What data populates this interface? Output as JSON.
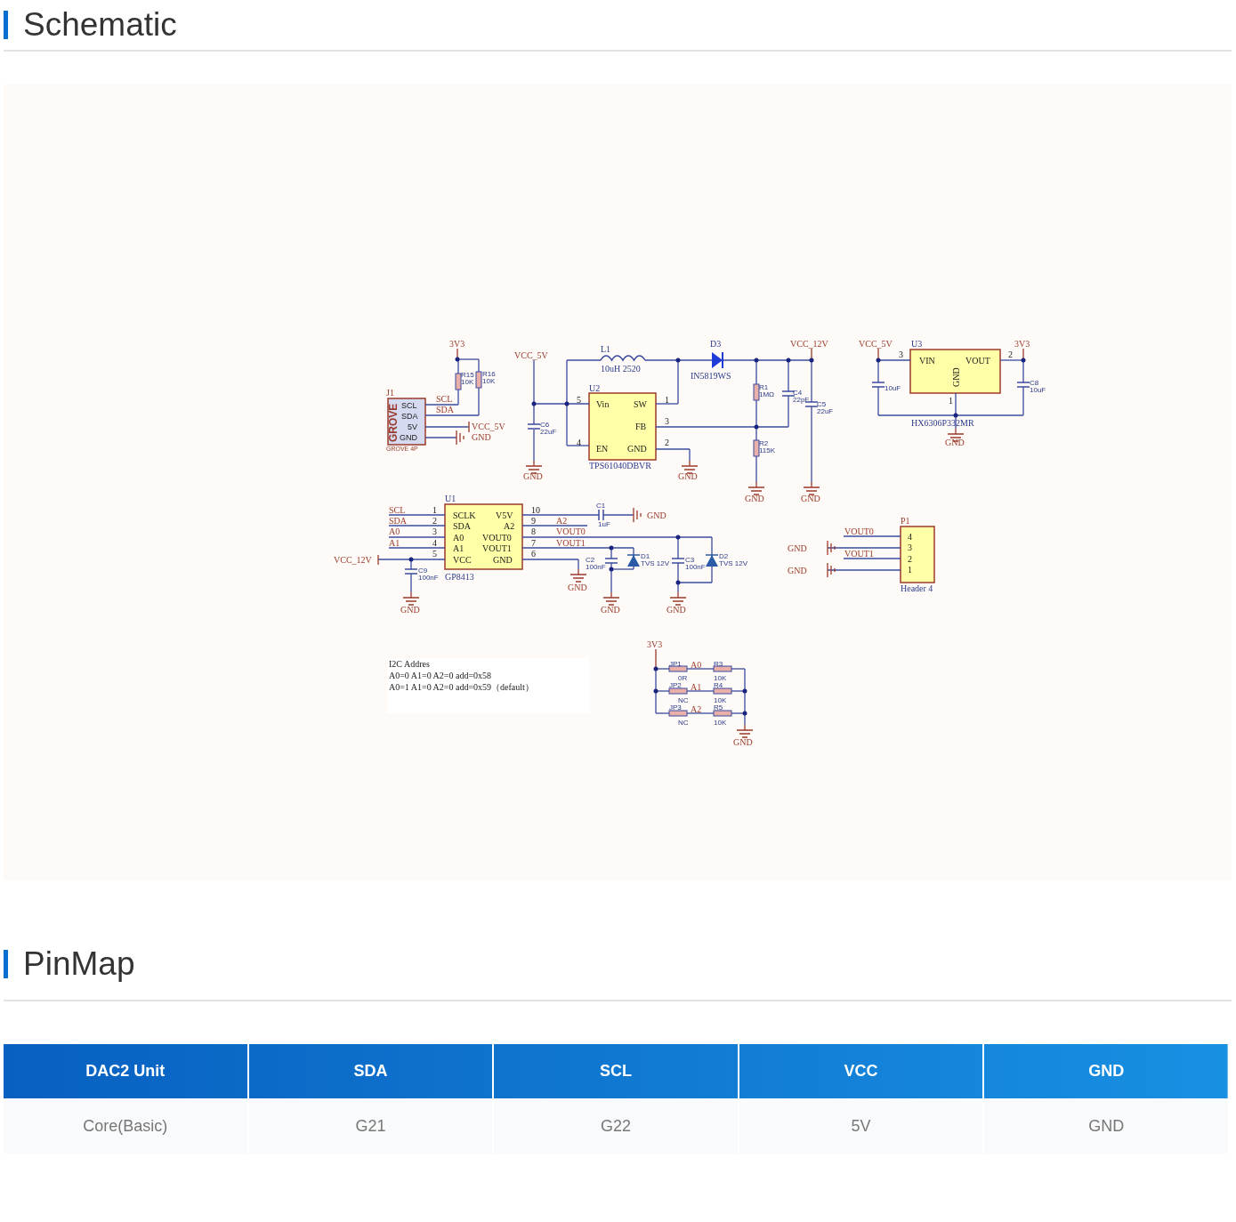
{
  "sections": [
    {
      "title": "Schematic"
    },
    {
      "title": "PinMap"
    }
  ],
  "schematic": {
    "labels": [
      {
        "text": "3V3",
        "kind": "net"
      },
      {
        "text": "R15",
        "kind": "value"
      },
      {
        "text": "10K",
        "kind": "value"
      },
      {
        "text": "R16",
        "kind": "value"
      },
      {
        "text": "10K",
        "kind": "value"
      },
      {
        "text": "J1",
        "kind": "net"
      },
      {
        "text": "GROVE",
        "kind": "grove"
      },
      {
        "text": "SCL",
        "kind": "sans"
      },
      {
        "text": "SDA",
        "kind": "sans"
      },
      {
        "text": "5V",
        "kind": "sans"
      },
      {
        "text": "GND",
        "kind": "sans"
      },
      {
        "text": "GROVE 4P",
        "kind": "small"
      },
      {
        "text": "SCL",
        "kind": "net"
      },
      {
        "text": "SDA",
        "kind": "net"
      },
      {
        "text": "VCC_5V",
        "kind": "net"
      },
      {
        "text": "GND",
        "kind": "net"
      },
      {
        "text": "VCC_5V",
        "kind": "net"
      },
      {
        "text": "C6",
        "kind": "value"
      },
      {
        "text": "22uF",
        "kind": "value"
      },
      {
        "text": "GND",
        "kind": "net"
      },
      {
        "text": "L1",
        "kind": "ref"
      },
      {
        "text": "10uH 2520",
        "kind": "ref"
      },
      {
        "text": "D3",
        "kind": "ref"
      },
      {
        "text": "VCC_12V",
        "kind": "net"
      },
      {
        "text": "IN5819WS",
        "kind": "ref"
      },
      {
        "text": "U2",
        "kind": "ref"
      },
      {
        "text": "5",
        "kind": "chip"
      },
      {
        "text": "Vin",
        "kind": "chip"
      },
      {
        "text": "SW",
        "kind": "chip"
      },
      {
        "text": "1",
        "kind": "chip"
      },
      {
        "text": "FB",
        "kind": "chip"
      },
      {
        "text": "3",
        "kind": "chip"
      },
      {
        "text": "4",
        "kind": "chip"
      },
      {
        "text": "EN",
        "kind": "chip"
      },
      {
        "text": "GND",
        "kind": "chip"
      },
      {
        "text": "2",
        "kind": "chip"
      },
      {
        "text": "TPS61040DBVR",
        "kind": "ref"
      },
      {
        "text": "GND",
        "kind": "net"
      },
      {
        "text": "R1",
        "kind": "value"
      },
      {
        "text": "1MΩ",
        "kind": "value"
      },
      {
        "text": "R2",
        "kind": "value"
      },
      {
        "text": "115K",
        "kind": "value"
      },
      {
        "text": "C4",
        "kind": "value"
      },
      {
        "text": "22pF",
        "kind": "value"
      },
      {
        "text": "C5",
        "kind": "value"
      },
      {
        "text": "22uF",
        "kind": "value"
      },
      {
        "text": "GND",
        "kind": "net"
      },
      {
        "text": "GND",
        "kind": "net"
      },
      {
        "text": "VCC_5V",
        "kind": "net"
      },
      {
        "text": "U3",
        "kind": "ref"
      },
      {
        "text": "3V3",
        "kind": "net"
      },
      {
        "text": "3",
        "kind": "chip"
      },
      {
        "text": "VIN",
        "kind": "chip"
      },
      {
        "text": "VOUT",
        "kind": "chip"
      },
      {
        "text": "2",
        "kind": "chip"
      },
      {
        "text": "GND",
        "kind": "chip"
      },
      {
        "text": "10uF",
        "kind": "value"
      },
      {
        "text": "C8",
        "kind": "value"
      },
      {
        "text": "10uF",
        "kind": "value"
      },
      {
        "text": "1",
        "kind": "chip"
      },
      {
        "text": "HX6306P332MR",
        "kind": "ref"
      },
      {
        "text": "GND",
        "kind": "net"
      },
      {
        "text": "U1",
        "kind": "ref"
      },
      {
        "text": "SCL",
        "kind": "net"
      },
      {
        "text": "SDA",
        "kind": "net"
      },
      {
        "text": "A0",
        "kind": "net"
      },
      {
        "text": "A1",
        "kind": "net"
      },
      {
        "text": "1",
        "kind": "chip"
      },
      {
        "text": "2",
        "kind": "chip"
      },
      {
        "text": "3",
        "kind": "chip"
      },
      {
        "text": "4",
        "kind": "chip"
      },
      {
        "text": "5",
        "kind": "chip"
      },
      {
        "text": "SCLK",
        "kind": "chip"
      },
      {
        "text": "V5V",
        "kind": "chip"
      },
      {
        "text": "SDA",
        "kind": "chip"
      },
      {
        "text": "A2",
        "kind": "chip"
      },
      {
        "text": "A0",
        "kind": "chip"
      },
      {
        "text": "VOUT0",
        "kind": "chip"
      },
      {
        "text": "A1",
        "kind": "chip"
      },
      {
        "text": "VOUT1",
        "kind": "chip"
      },
      {
        "text": "VCC",
        "kind": "chip"
      },
      {
        "text": "GND",
        "kind": "chip"
      },
      {
        "text": "10",
        "kind": "chip"
      },
      {
        "text": "9",
        "kind": "chip"
      },
      {
        "text": "8",
        "kind": "chip"
      },
      {
        "text": "7",
        "kind": "chip"
      },
      {
        "text": "6",
        "kind": "chip"
      },
      {
        "text": "A2",
        "kind": "net"
      },
      {
        "text": "VOUT0",
        "kind": "net"
      },
      {
        "text": "VOUT1",
        "kind": "net"
      },
      {
        "text": "C1",
        "kind": "value"
      },
      {
        "text": "1uF",
        "kind": "value"
      },
      {
        "text": "GND",
        "kind": "net"
      },
      {
        "text": "VCC_12V",
        "kind": "net"
      },
      {
        "text": "C9",
        "kind": "value"
      },
      {
        "text": "100nF",
        "kind": "value"
      },
      {
        "text": "GP8413",
        "kind": "ref"
      },
      {
        "text": "GND",
        "kind": "net"
      },
      {
        "text": "GND",
        "kind": "net"
      },
      {
        "text": "C2",
        "kind": "value"
      },
      {
        "text": "100nF",
        "kind": "value"
      },
      {
        "text": "D1",
        "kind": "value"
      },
      {
        "text": "TVS 12V",
        "kind": "value"
      },
      {
        "text": "GND",
        "kind": "net"
      },
      {
        "text": "C3",
        "kind": "value"
      },
      {
        "text": "100nF",
        "kind": "value"
      },
      {
        "text": "D2",
        "kind": "value"
      },
      {
        "text": "TVS 12V",
        "kind": "value"
      },
      {
        "text": "GND",
        "kind": "net"
      },
      {
        "text": "P1",
        "kind": "net"
      },
      {
        "text": "4",
        "kind": "chip"
      },
      {
        "text": "3",
        "kind": "chip"
      },
      {
        "text": "2",
        "kind": "chip"
      },
      {
        "text": "1",
        "kind": "chip"
      },
      {
        "text": "Header 4",
        "kind": "ref"
      },
      {
        "text": "VOUT0",
        "kind": "net"
      },
      {
        "text": "VOUT1",
        "kind": "net"
      },
      {
        "text": "GND",
        "kind": "net"
      },
      {
        "text": "GND",
        "kind": "net"
      },
      {
        "text": "I2C Addres",
        "kind": "note"
      },
      {
        "text": "A0=0 A1=0 A2=0 add=0x58",
        "kind": "note"
      },
      {
        "text": "A0=1 A1=0 A2=0 add=0x59（default）",
        "kind": "note"
      },
      {
        "text": "3V3",
        "kind": "net"
      },
      {
        "text": "JP1",
        "kind": "value"
      },
      {
        "text": "A0",
        "kind": "net"
      },
      {
        "text": "R3",
        "kind": "value"
      },
      {
        "text": "0R",
        "kind": "value"
      },
      {
        "text": "10K",
        "kind": "value"
      },
      {
        "text": "JP2",
        "kind": "value"
      },
      {
        "text": "A1",
        "kind": "net"
      },
      {
        "text": "R4",
        "kind": "value"
      },
      {
        "text": "NC",
        "kind": "value"
      },
      {
        "text": "10K",
        "kind": "value"
      },
      {
        "text": "JP3",
        "kind": "value"
      },
      {
        "text": "A2",
        "kind": "net"
      },
      {
        "text": "R5",
        "kind": "value"
      },
      {
        "text": "NC",
        "kind": "value"
      },
      {
        "text": "10K",
        "kind": "value"
      },
      {
        "text": "GND",
        "kind": "net"
      }
    ]
  },
  "pinmap": {
    "columns": [
      "DAC2 Unit",
      "SDA",
      "SCL",
      "VCC",
      "GND"
    ],
    "rows": [
      [
        "Core(Basic)",
        "G21",
        "G22",
        "5V",
        "GND"
      ]
    ]
  }
}
